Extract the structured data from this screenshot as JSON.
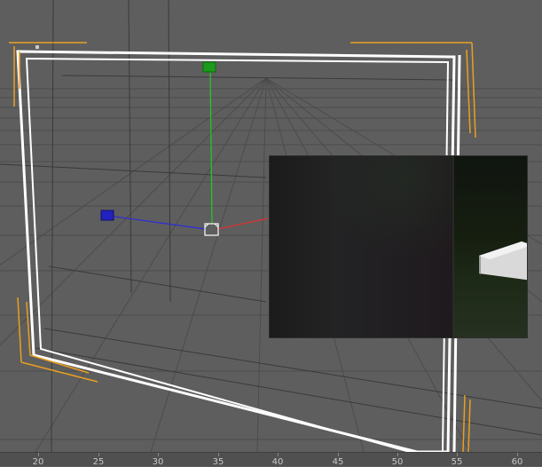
{
  "viewport": {
    "grid_color": "#4a4a4a",
    "frame_color": "#ffffff",
    "corner_marker_color": "#e8a020",
    "axis_colors": {
      "x": "#e03030",
      "y": "#22cc22",
      "z": "#2a2ae0"
    },
    "gizmo_icon": "transform-gizmo-icon",
    "light_icon": "light-object-icon"
  },
  "preview": {
    "label": "render-preview-window"
  },
  "timeline": {
    "ticks": [
      "20",
      "25",
      "30",
      "35",
      "40",
      "45",
      "50",
      "55",
      "60"
    ]
  }
}
